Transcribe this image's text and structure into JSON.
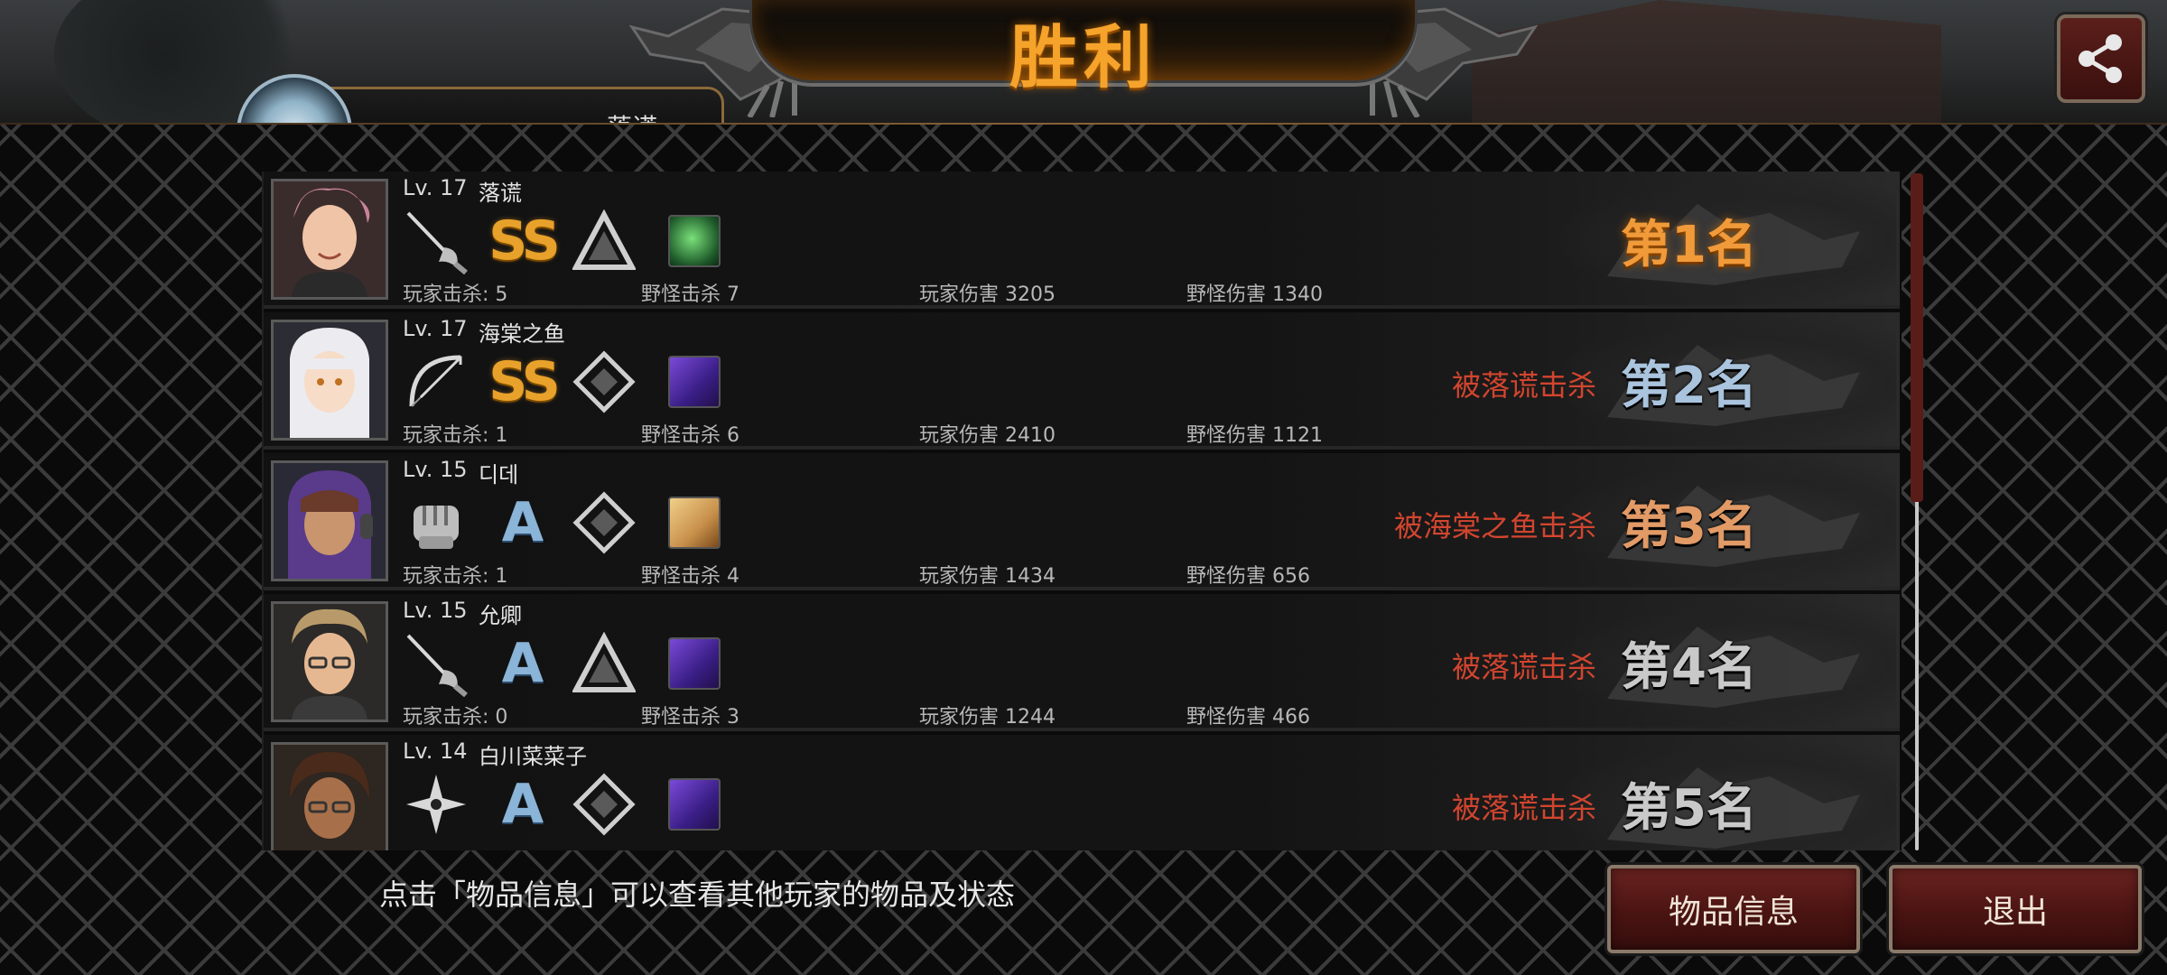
{
  "header": {
    "title": "胜利",
    "own_player_name": "落谎",
    "share_icon": "share-icon"
  },
  "results": [
    {
      "level": "Lv. 17",
      "name": "落谎",
      "weapon_icon": "rapier-icon",
      "grade": "SS",
      "emblem_icon": "triangle-emblem-icon",
      "item_icon": "green-item-icon",
      "player_kills": "玩家击杀: 5",
      "monster_kills": "野怪击杀 7",
      "player_damage": "玩家伤害 3205",
      "monster_damage": "野怪伤害 1340",
      "killed_by": "",
      "rank": "第1名"
    },
    {
      "level": "Lv. 17",
      "name": "海棠之鱼",
      "weapon_icon": "bow-icon",
      "grade": "SS",
      "emblem_icon": "diamond-emblem-icon",
      "item_icon": "purple-item-icon",
      "player_kills": "玩家击杀: 1",
      "monster_kills": "野怪击杀 6",
      "player_damage": "玩家伤害 2410",
      "monster_damage": "野怪伤害 1121",
      "killed_by": "被落谎击杀",
      "rank": "第2名"
    },
    {
      "level": "Lv. 15",
      "name": "디데",
      "weapon_icon": "fist-icon",
      "grade": "A",
      "emblem_icon": "diamond-emblem-icon",
      "item_icon": "gold-item-icon",
      "player_kills": "玩家击杀: 1",
      "monster_kills": "野怪击杀 4",
      "player_damage": "玩家伤害 1434",
      "monster_damage": "野怪伤害 656",
      "killed_by": "被海棠之鱼击杀",
      "rank": "第3名"
    },
    {
      "level": "Lv. 15",
      "name": "允卿",
      "weapon_icon": "rapier-icon",
      "grade": "A",
      "emblem_icon": "triangle-emblem-icon",
      "item_icon": "purple-item-icon",
      "player_kills": "玩家击杀: 0",
      "monster_kills": "野怪击杀 3",
      "player_damage": "玩家伤害 1244",
      "monster_damage": "野怪伤害 466",
      "killed_by": "被落谎击杀",
      "rank": "第4名"
    },
    {
      "level": "Lv. 14",
      "name": "白川菜菜子",
      "weapon_icon": "shuriken-icon",
      "grade": "A",
      "emblem_icon": "diamond-emblem-icon",
      "item_icon": "purple-item-icon",
      "killed_by": "被落谎击杀",
      "rank": "第5名"
    }
  ],
  "footer": {
    "hint": "点击「物品信息」可以查看其他玩家的物品及状态",
    "item_info_label": "物品信息",
    "exit_label": "退出"
  },
  "colors": {
    "title": "#f5a32a",
    "killed_by": "#d2452f",
    "button_bg": "#4a1412",
    "rank1": "#f19a3a"
  }
}
